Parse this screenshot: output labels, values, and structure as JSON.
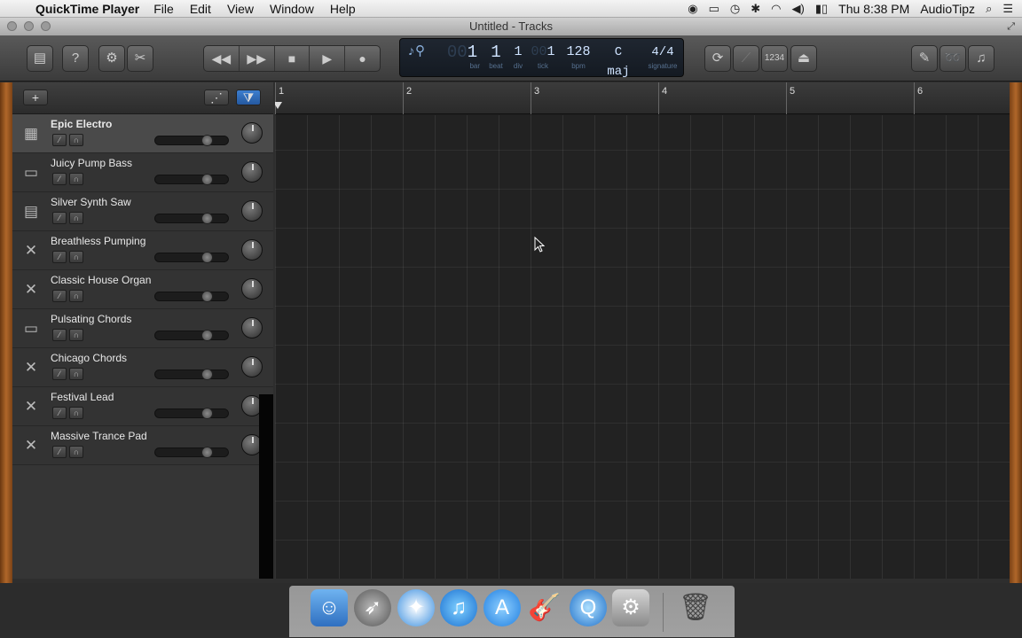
{
  "menubar": {
    "app_name": "QuickTime Player",
    "menus": [
      "File",
      "Edit",
      "View",
      "Window",
      "Help"
    ],
    "clock": "Thu 8:38 PM",
    "user": "AudioTipz"
  },
  "window": {
    "title": "Untitled - Tracks"
  },
  "lcd": {
    "bar": "1",
    "beat": "1",
    "div": "1",
    "tick": "1",
    "tempo": "128",
    "key": "C maj",
    "signature": "4/4",
    "labels": {
      "bar": "bar",
      "beat": "beat",
      "div": "div",
      "tick": "tick",
      "bpm": "bpm",
      "key": "key",
      "signature": "signature"
    }
  },
  "toolbar": {
    "count_in_label": "1234"
  },
  "tracks": [
    {
      "name": "Epic Electro",
      "icon": "drum-machine-icon",
      "selected": true
    },
    {
      "name": "Juicy Pump Bass",
      "icon": "synth-keyboard-icon",
      "selected": false
    },
    {
      "name": "Silver Synth Saw",
      "icon": "synth-module-icon",
      "selected": false
    },
    {
      "name": "Breathless Pumping",
      "icon": "keyboard-stand-icon",
      "selected": false
    },
    {
      "name": "Classic House Organ",
      "icon": "keyboard-stand-icon",
      "selected": false
    },
    {
      "name": "Pulsating Chords",
      "icon": "synth-keyboard-icon",
      "selected": false
    },
    {
      "name": "Chicago Chords",
      "icon": "keyboard-stand-icon",
      "selected": false
    },
    {
      "name": "Festival Lead",
      "icon": "keyboard-stand-icon",
      "selected": false
    },
    {
      "name": "Massive Trance Pad",
      "icon": "keyboard-stand-icon",
      "selected": false
    }
  ],
  "ruler": {
    "bars": [
      "1",
      "2",
      "3",
      "4",
      "5",
      "6"
    ]
  },
  "dock": {
    "apps": [
      "Finder",
      "Launchpad",
      "Safari",
      "iTunes",
      "App Store",
      "GarageBand",
      "QuickTime Player",
      "System Preferences",
      "Trash"
    ]
  }
}
